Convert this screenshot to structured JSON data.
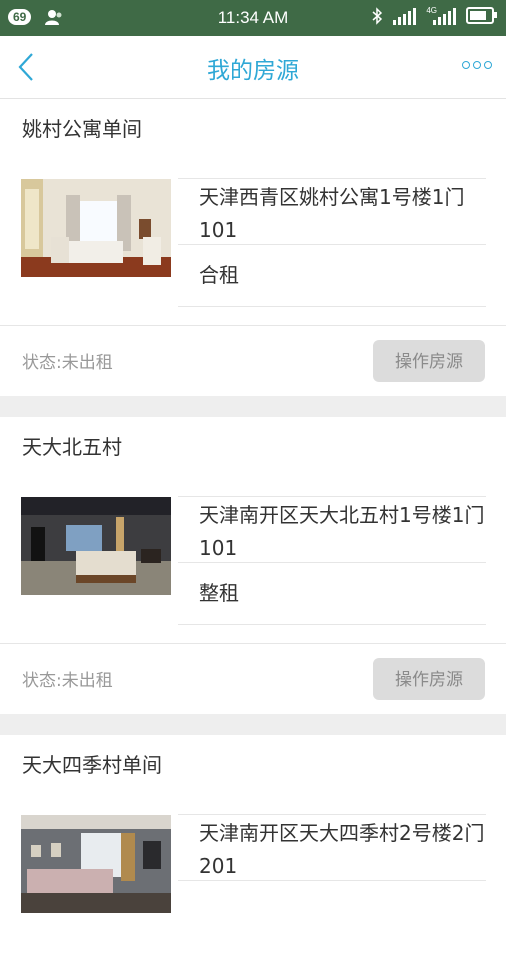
{
  "status_bar": {
    "notif_count": "69",
    "time": "11:34 AM",
    "network": "4G"
  },
  "header": {
    "title": "我的房源"
  },
  "listings": [
    {
      "name": "姚村公寓单间",
      "address": "天津西青区姚村公寓1号楼1门101",
      "rent_type": "合租",
      "status": "状态:未出租",
      "action": "操作房源"
    },
    {
      "name": "天大北五村",
      "address": "天津南开区天大北五村1号楼1门101",
      "rent_type": "整租",
      "status": "状态:未出租",
      "action": "操作房源"
    },
    {
      "name": "天大四季村单间",
      "address": "天津南开区天大四季村2号楼2门201",
      "rent_type": "",
      "status": "",
      "action": ""
    }
  ]
}
